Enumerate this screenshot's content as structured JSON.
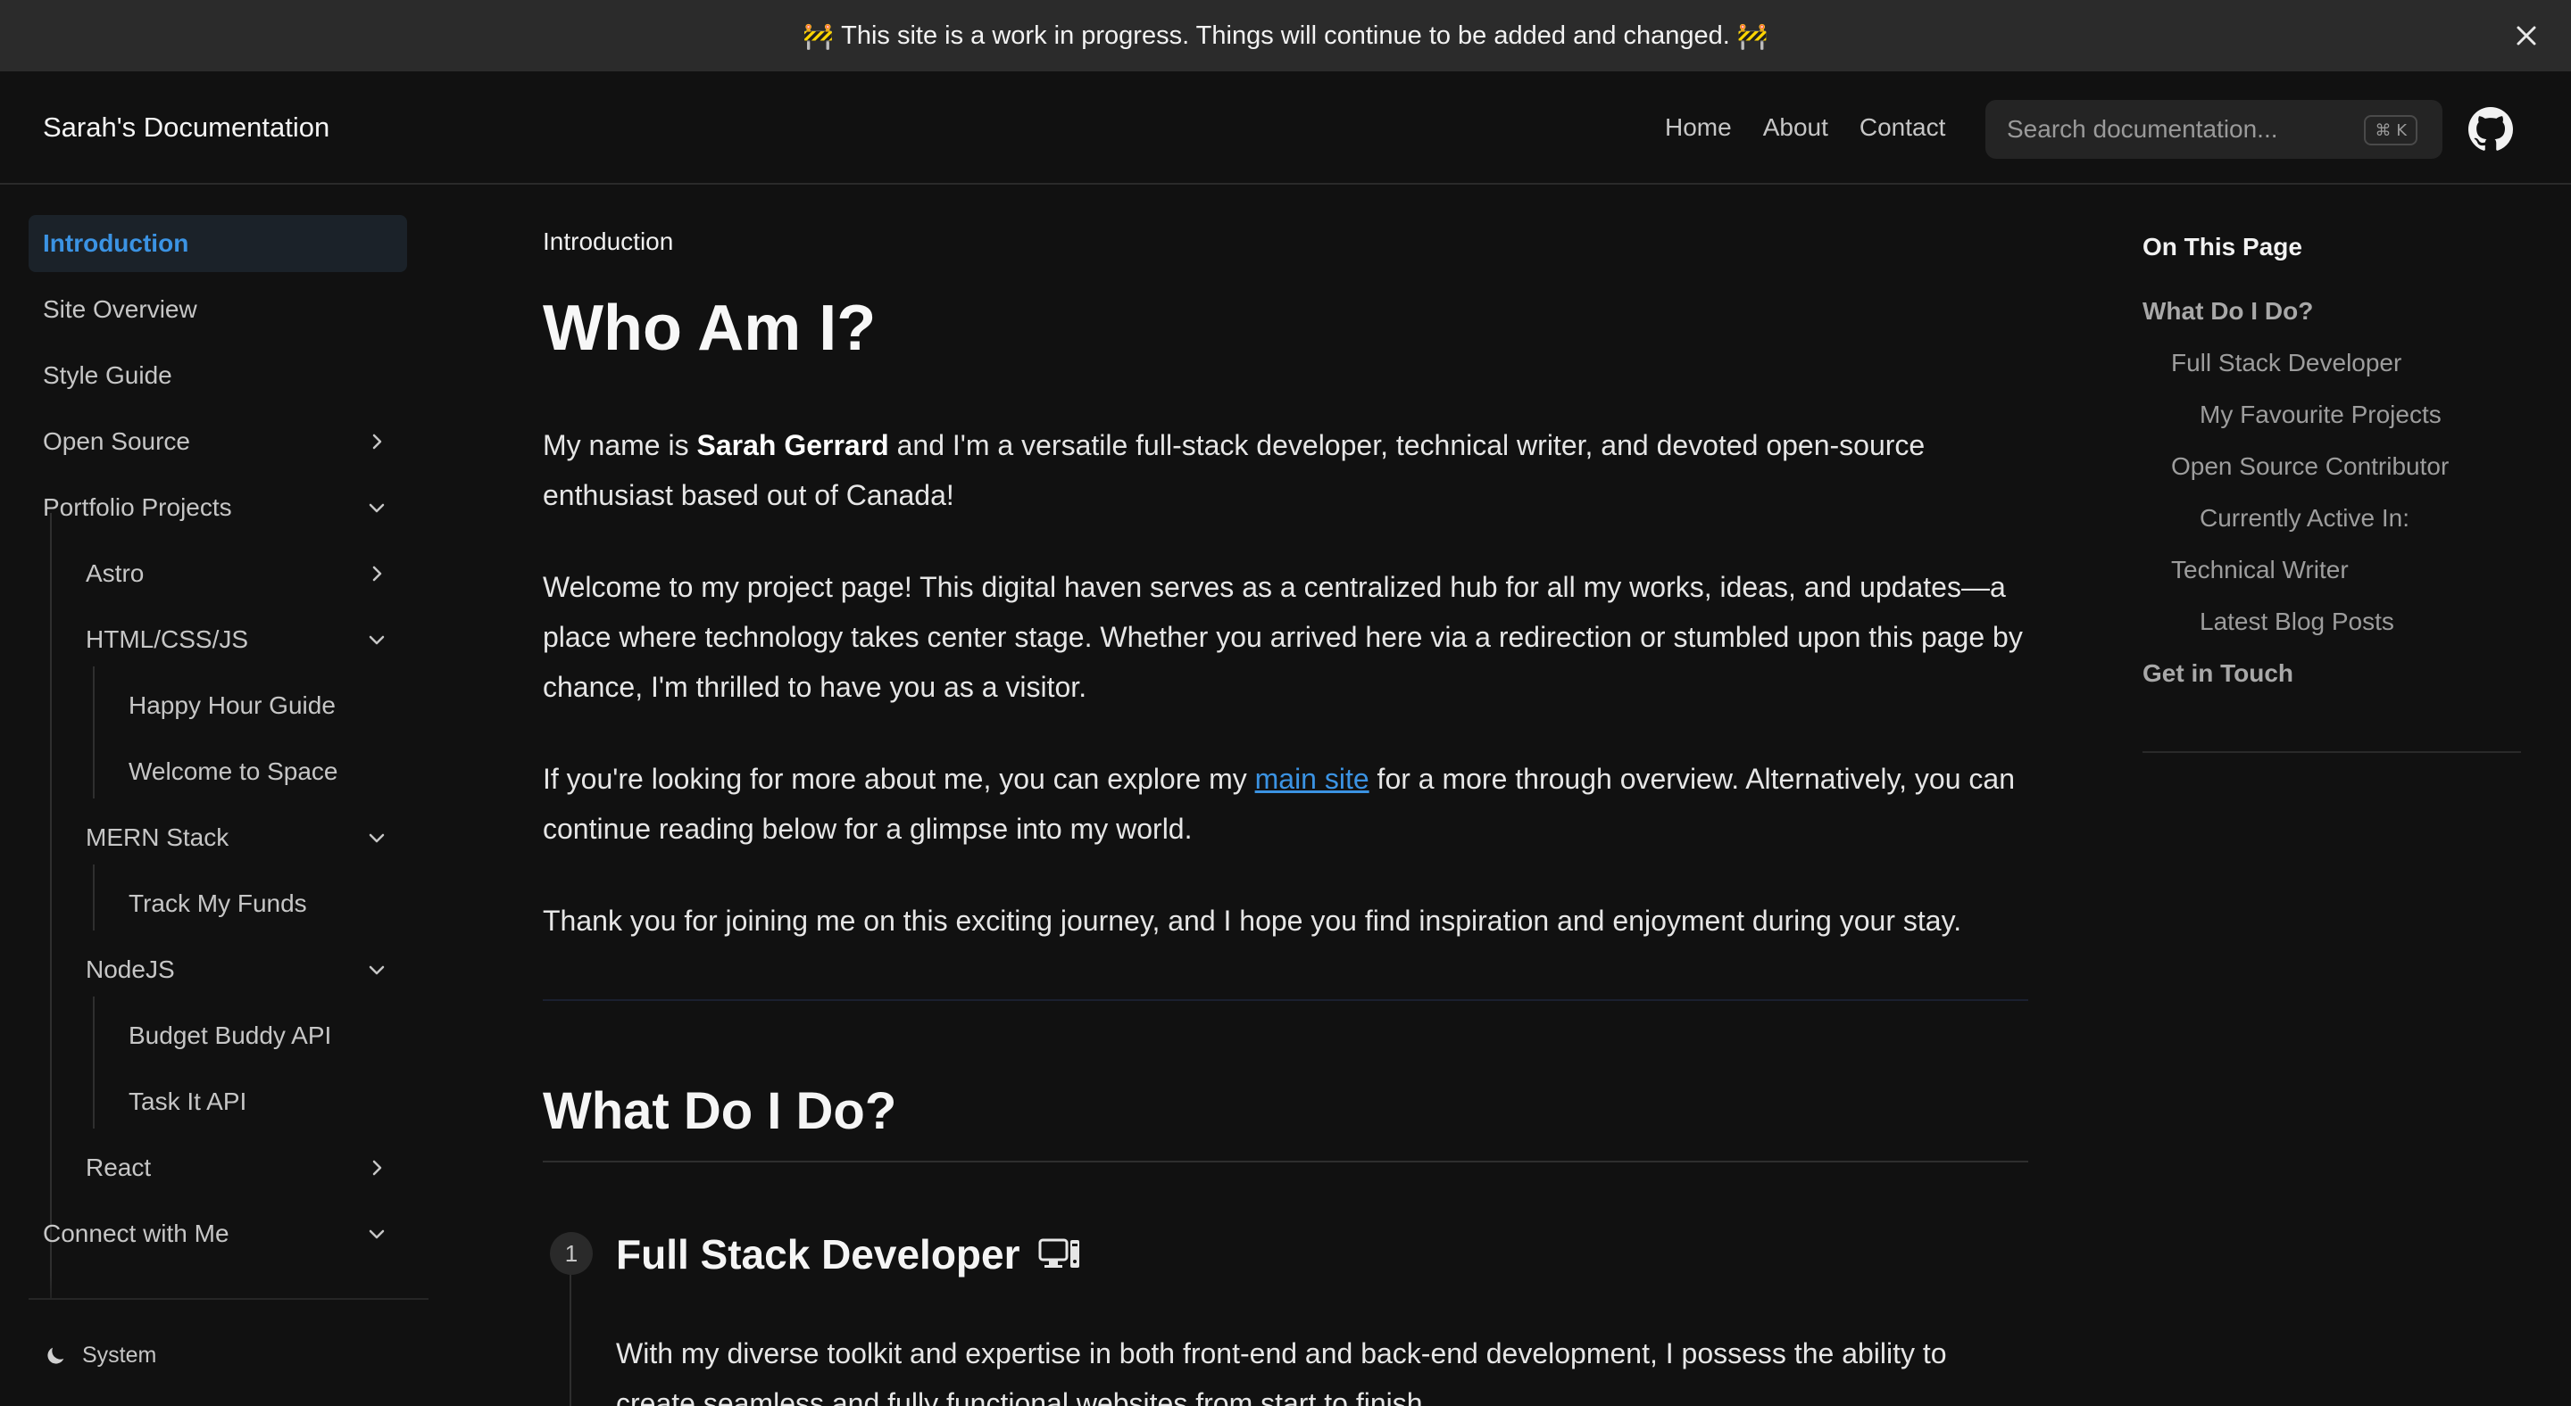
{
  "banner": {
    "emoji": "🚧",
    "text": "This site is a work in progress. Things will continue to be added and changed.",
    "close_icon": "close-icon"
  },
  "navbar": {
    "brand": "Sarah's Documentation",
    "links": [
      "Home",
      "About",
      "Contact"
    ],
    "search_placeholder": "Search documentation...",
    "search_shortcut": "⌘ K",
    "github_icon": "github-icon"
  },
  "sidebar": {
    "items": [
      {
        "label": "Introduction",
        "active": true
      },
      {
        "label": "Site Overview"
      },
      {
        "label": "Style Guide"
      },
      {
        "label": "Open Source",
        "chevron": "right"
      },
      {
        "label": "Portfolio Projects",
        "chevron": "down"
      },
      {
        "label": "Astro",
        "chevron": "right"
      },
      {
        "label": "HTML/CSS/JS",
        "chevron": "down"
      },
      {
        "label": "Happy Hour Guide"
      },
      {
        "label": "Welcome to Space"
      },
      {
        "label": "MERN Stack",
        "chevron": "down"
      },
      {
        "label": "Track My Funds"
      },
      {
        "label": "NodeJS",
        "chevron": "down"
      },
      {
        "label": "Budget Buddy API"
      },
      {
        "label": "Task It API"
      },
      {
        "label": "React",
        "chevron": "right"
      },
      {
        "label": "Connect with Me",
        "chevron": "down"
      }
    ],
    "theme_label": "System",
    "theme_icon": "moon-icon"
  },
  "main": {
    "breadcrumb": "Introduction",
    "title": "Who Am I?",
    "intro": {
      "p1_before": "My name is ",
      "p1_name": "Sarah Gerrard",
      "p1_after": " and I'm a versatile full-stack developer, technical writer, and devoted open-source enthusiast based out of Canada!",
      "p2": "Welcome to my project page! This digital haven serves as a centralized hub for all my works, ideas, and updates—a place where technology takes center stage. Whether you arrived here via a redirection or stumbled upon this page by chance, I'm thrilled to have you as a visitor.",
      "p3_before": "If you're looking for more about me, you can explore my ",
      "p3_link": "main site",
      "p3_after": " for a more through overview. Alternatively, you can continue reading below for a glimpse into my world.",
      "p4": "Thank you for joining me on this exciting journey, and I hope you find inspiration and enjoyment during your stay."
    },
    "section_title": "What Do I Do?",
    "step": {
      "number": "1",
      "title": "Full Stack Developer",
      "icon": "computer-icon",
      "text": "With my diverse toolkit and expertise in both front-end and back-end development, I possess the ability to create seamless and fully functional websites from start to finish."
    }
  },
  "toc": {
    "title": "On This Page",
    "items": [
      {
        "label": "What Do I Do?",
        "level": 0
      },
      {
        "label": "Full Stack Developer",
        "level": 1
      },
      {
        "label": "My Favourite Projects",
        "level": 2
      },
      {
        "label": "Open Source Contributor",
        "level": 1
      },
      {
        "label": "Currently Active In:",
        "level": 2
      },
      {
        "label": "Technical Writer",
        "level": 1
      },
      {
        "label": "Latest Blog Posts",
        "level": 2
      },
      {
        "label": "Get in Touch",
        "level": 0
      }
    ]
  },
  "colors": {
    "background": "#111111",
    "accent": "#3b93e3",
    "banner_bg": "#2b2b2b"
  }
}
